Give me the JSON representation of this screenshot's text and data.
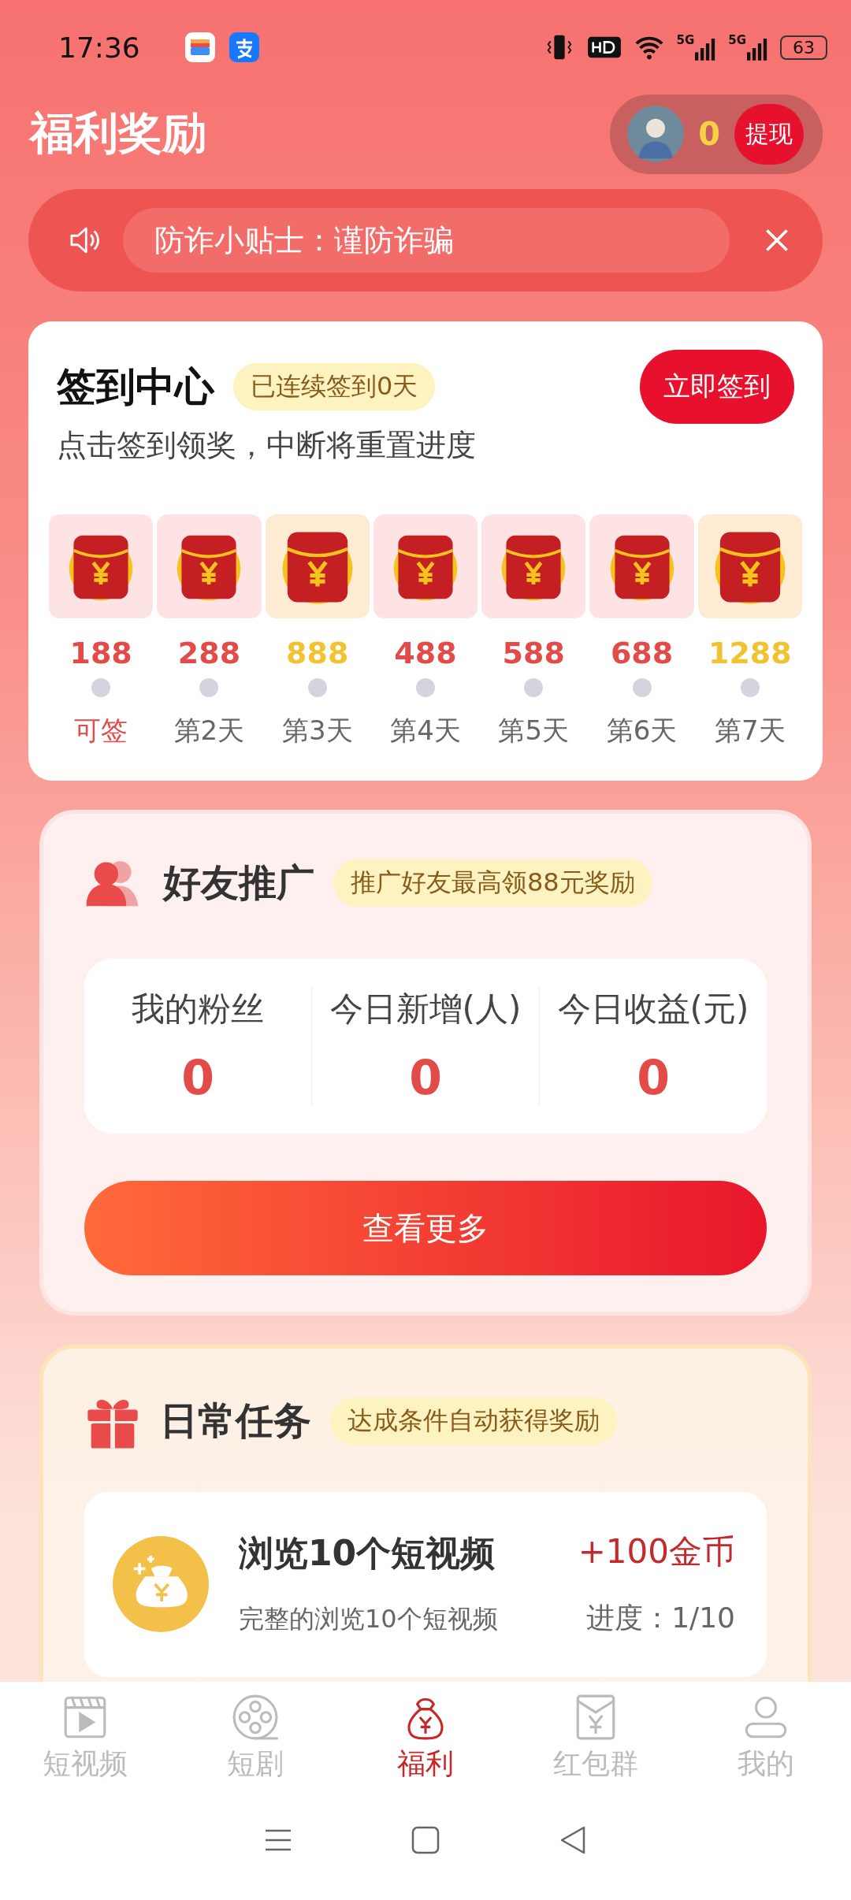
{
  "status_bar": {
    "time": "17:36",
    "networks": [
      "5G",
      "5G"
    ],
    "battery": "63"
  },
  "header": {
    "title": "福利奖励",
    "coins": "0",
    "withdraw": "提现"
  },
  "notice": {
    "text": "防诈小贴士：谨防诈骗"
  },
  "checkin": {
    "title": "签到中心",
    "streak_badge": "已连续签到0天",
    "button": "立即签到",
    "subtitle": "点击签到领奖，中断将重置进度",
    "days": [
      {
        "amount": "188",
        "label": "可签",
        "kind": "normal",
        "available": true
      },
      {
        "amount": "288",
        "label": "第2天",
        "kind": "normal",
        "available": false
      },
      {
        "amount": "888",
        "label": "第3天",
        "kind": "big",
        "available": false
      },
      {
        "amount": "488",
        "label": "第4天",
        "kind": "normal",
        "available": false
      },
      {
        "amount": "588",
        "label": "第5天",
        "kind": "normal",
        "available": false
      },
      {
        "amount": "688",
        "label": "第6天",
        "kind": "normal",
        "available": false
      },
      {
        "amount": "1288",
        "label": "第7天",
        "kind": "big",
        "available": false
      }
    ]
  },
  "friends": {
    "title": "好友推广",
    "badge": "推广好友最高领88元奖励",
    "stats": [
      {
        "label": "我的粉丝",
        "value": "0"
      },
      {
        "label": "今日新增(人)",
        "value": "0"
      },
      {
        "label": "今日收益(元)",
        "value": "0"
      }
    ],
    "button": "查看更多"
  },
  "daily_tasks": {
    "title": "日常任务",
    "badge": "达成条件自动获得奖励",
    "tasks": [
      {
        "title": "浏览10个短视频",
        "reward": "+100金币",
        "description": "完整的浏览10个短视频",
        "progress": "进度：1/10"
      }
    ]
  },
  "bottom_nav": [
    {
      "label": "短视频",
      "kind": "video",
      "selected": false
    },
    {
      "label": "短剧",
      "kind": "reel",
      "selected": false
    },
    {
      "label": "福利",
      "kind": "bag",
      "selected": true
    },
    {
      "label": "红包群",
      "kind": "envelope",
      "selected": false
    },
    {
      "label": "我的",
      "kind": "user",
      "selected": false
    }
  ]
}
